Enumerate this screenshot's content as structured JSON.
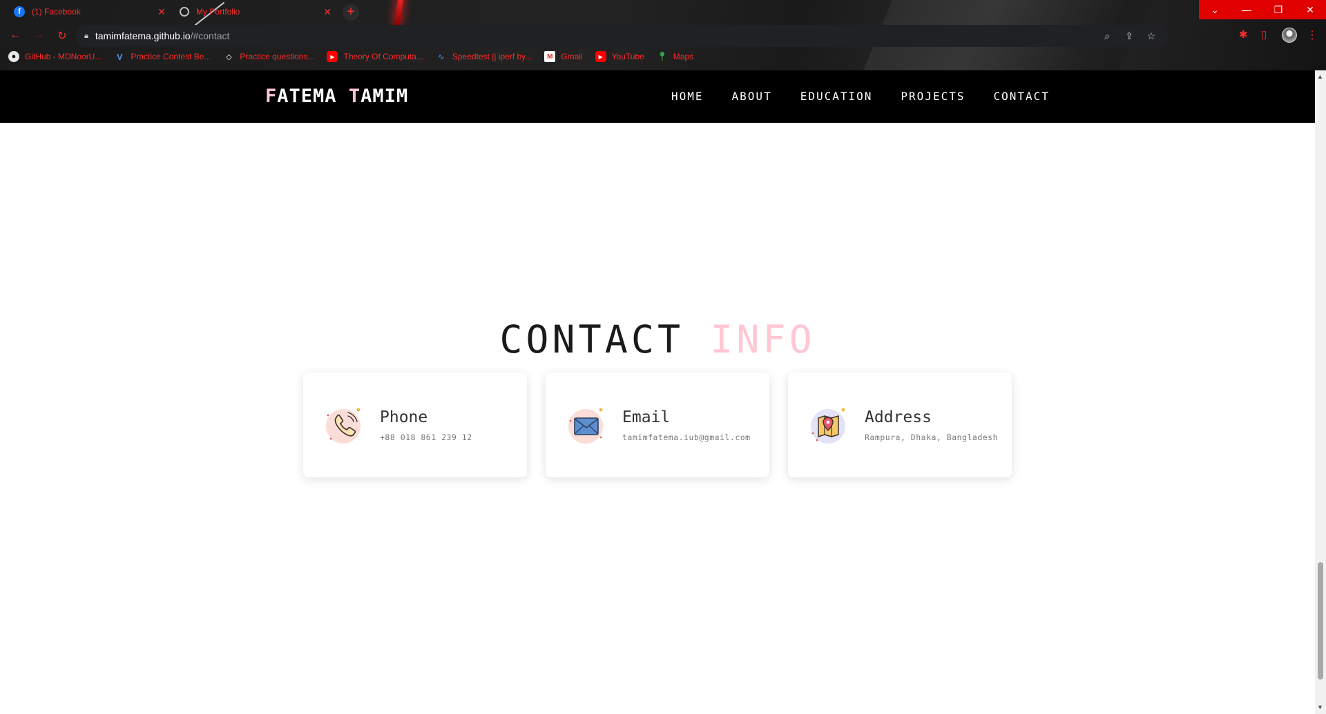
{
  "browser": {
    "tabs": [
      {
        "title": "(1) Facebook",
        "icon": "facebook-icon"
      },
      {
        "title": "My Portfolio",
        "icon": "globe-icon"
      }
    ],
    "url_host": "tamimfatema.github.io",
    "url_path": "/#contact",
    "bookmarks": [
      {
        "label": "GitHub - MDNoorU...",
        "icon": "github-icon"
      },
      {
        "label": "Practice Contest Be...",
        "icon": "vjudge-icon"
      },
      {
        "label": "Practice questions...",
        "icon": "codechef-icon"
      },
      {
        "label": "Theory Of Computa...",
        "icon": "youtube-icon"
      },
      {
        "label": "Speedtest || iperf by...",
        "icon": "speedtest-icon"
      },
      {
        "label": "Gmail",
        "icon": "gmail-icon"
      },
      {
        "label": "YouTube",
        "icon": "youtube-icon"
      },
      {
        "label": "Maps",
        "icon": "maps-icon"
      }
    ],
    "accent_color": "#ff2a2a"
  },
  "site": {
    "brand_first_1": "F",
    "brand_rest_1": "ATEMA ",
    "brand_first_2": "T",
    "brand_rest_2": "AMIM",
    "nav": [
      "HOME",
      "ABOUT",
      "EDUCATION",
      "PROJECTS",
      "CONTACT"
    ],
    "accent_color": "#ffc6d3"
  },
  "contact": {
    "title_main": "CONTACT",
    "title_accent": "INFO",
    "cards": [
      {
        "label": "Phone",
        "value": "+88 018 861 239 12",
        "icon": "phone-icon"
      },
      {
        "label": "Email",
        "value": "tamimfatema.iub@gmail.com",
        "icon": "email-icon"
      },
      {
        "label": "Address",
        "value": "Rampura, Dhaka, Bangladesh",
        "icon": "map-pin-icon"
      }
    ]
  }
}
